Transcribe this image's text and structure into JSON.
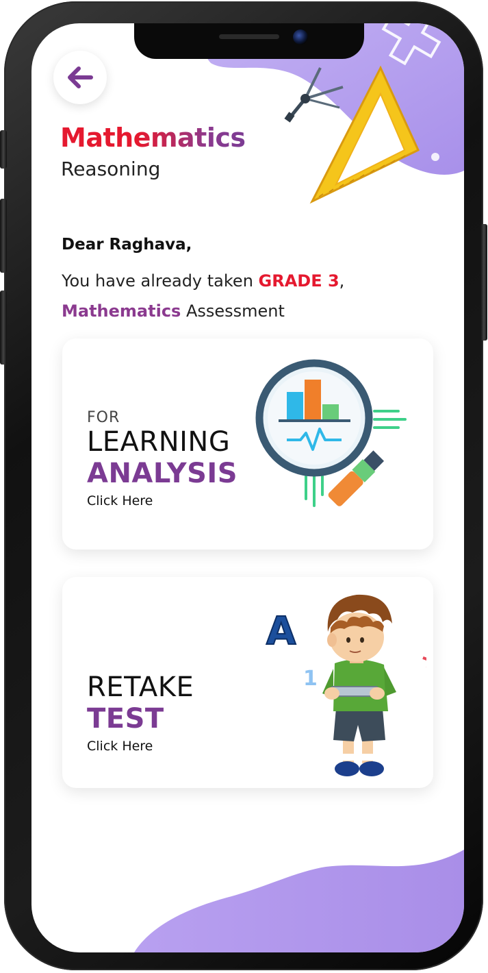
{
  "screen": {
    "title": "Mathematics",
    "subtitle": "Reasoning",
    "back_icon": "arrow-left-icon"
  },
  "message": {
    "greeting": "Dear Raghava,",
    "line1_prefix": "You have already taken ",
    "grade": "GRADE 3",
    "line1_suffix": ",",
    "subject": "Mathematics",
    "line2_suffix": " Assessment"
  },
  "cards": {
    "analysis": {
      "small": "FOR",
      "line1": "LEARNING",
      "line2": "ANALYSIS",
      "cta": "Click Here",
      "icon": "magnifier-chart-icon"
    },
    "retake": {
      "line1": "RETAKE",
      "line2": "TEST",
      "cta": "Click Here",
      "icon": "boy-with-tablet-illustration",
      "letters": {
        "a": "A",
        "one": "1",
        "plus": "+"
      }
    }
  },
  "colors": {
    "accent_red": "#e5192f",
    "accent_purple": "#7b3b93",
    "blob_purple": "#b39cf0"
  }
}
